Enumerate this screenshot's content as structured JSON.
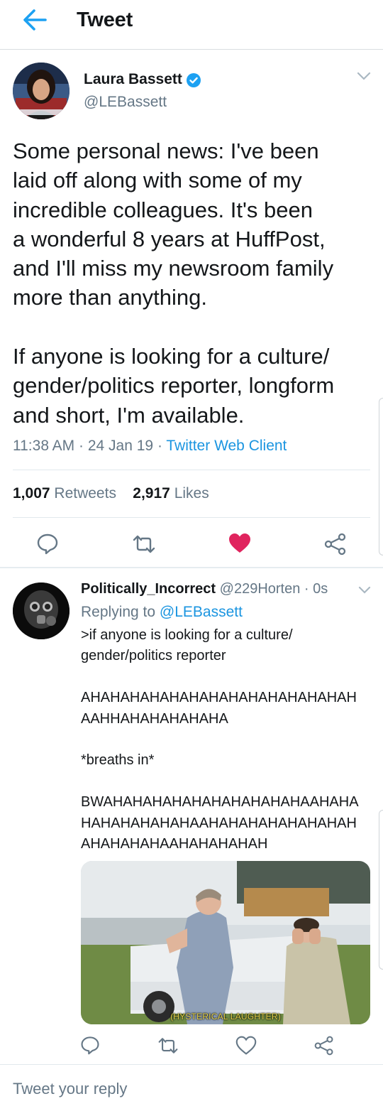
{
  "header": {
    "title": "Tweet"
  },
  "tweet": {
    "author_name": "Laura Bassett",
    "author_handle": "@LEBassett",
    "text": "Some personal news: I've been\nlaid off along with some of my\nincredible colleagues. It's been\na wonderful 8 years at HuffPost,\nand I'll miss my newsroom family\nmore than anything.\n\nIf anyone is looking for a culture/\ngender/politics reporter, longform\nand short, I'm available.",
    "time": "11:38 AM",
    "date": "24 Jan 19",
    "client": "Twitter Web Client",
    "retweets": "1,007",
    "retweets_label": "Retweets",
    "likes": "2,917",
    "likes_label": "Likes",
    "liked": true
  },
  "reply": {
    "author_name": "Politically_Incorrect",
    "author_handle": "@229Horten",
    "time": "0s",
    "replying_prefix": "Replying to",
    "replying_to": "@LEBassett",
    "text": ">if anyone is looking for a culture/\ngender/politics reporter\n\nAHAHAHAHAHAHAHAHAHAHAHAHAHAH\nAAHHAHAHAHAHAHA\n\n*breaths in*\n\nBWAHAHAHAHAHAHAHAHAHAHAAHAHA\nHAHAHAHAHAHAAHAHAHAHAHAHAHAH\nAHAHAHAHAAHAHAHAHAH",
    "media_caption": "(HYSTERICAL LAUGHTER)"
  },
  "composer": {
    "placeholder": "Tweet your reply"
  },
  "colors": {
    "accent": "#1da1f2",
    "like": "#e0245e",
    "muted": "#657786",
    "link": "#1b95e0"
  }
}
